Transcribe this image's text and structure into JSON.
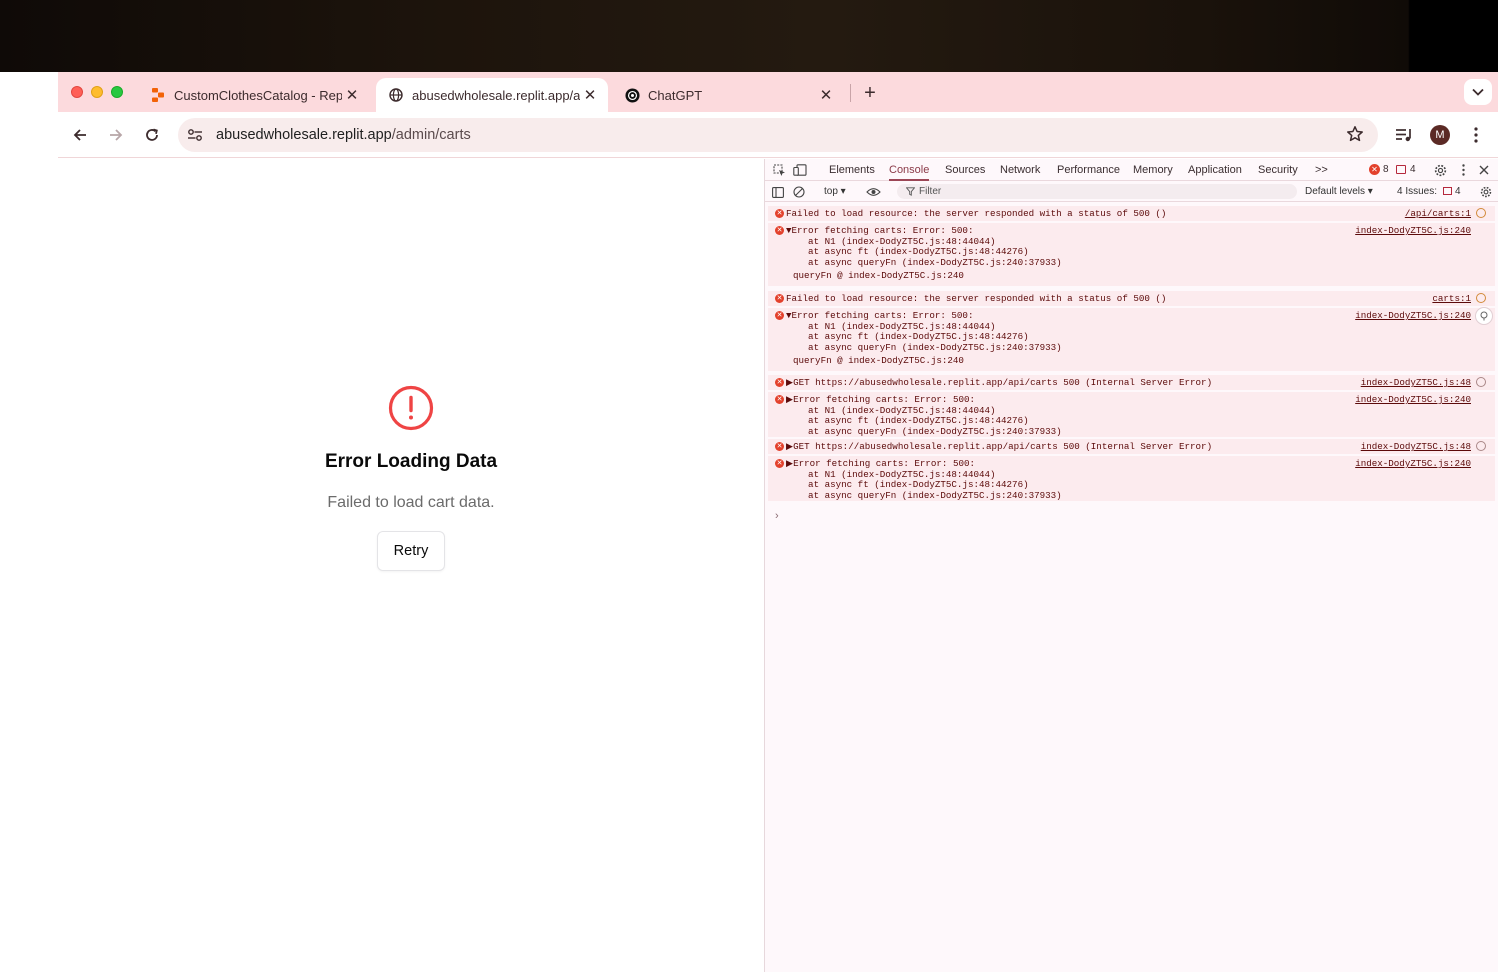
{
  "browser": {
    "tabs": [
      {
        "title": "CustomClothesCatalog - Replit",
        "close": "✕"
      },
      {
        "title": "abusedwholesale.replit.app/admin/carts",
        "close": "✕"
      },
      {
        "title": "ChatGPT",
        "close": "✕"
      }
    ],
    "new_tab": "+",
    "url_host": "abusedwholesale.replit.app",
    "url_path": "/admin/carts",
    "profile_initial": "M"
  },
  "page": {
    "error_title": "Error Loading Data",
    "error_message": "Failed to load cart data.",
    "retry_label": "Retry"
  },
  "devtools": {
    "tabs": [
      "Elements",
      "Console",
      "Sources",
      "Network",
      "Performance",
      "Memory",
      "Application",
      "Security"
    ],
    "more": ">>",
    "error_count": "8",
    "warning_count": "4",
    "context": "top ▾",
    "filter_placeholder": "Filter",
    "levels": "Default levels ▾",
    "issues": "4 Issues:",
    "issues_count": "4",
    "messages": [
      {
        "lines": [
          "Failed to load resource: the server responded with a status of 500 ()"
        ],
        "source": "/api/carts:1"
      },
      {
        "lines": [
          "▼Error fetching carts: Error: 500:",
          "    at N1 (index-DodyZT5C.js:48:44044)",
          "    at async ft (index-DodyZT5C.js:48:44276)",
          "    at async queryFn (index-DodyZT5C.js:240:37933)",
          "queryFn @ index-DodyZT5C.js:240"
        ],
        "source": "index-DodyZT5C.js:240"
      },
      {
        "lines": [
          "Failed to load resource: the server responded with a status of 500 ()"
        ],
        "source": "carts:1"
      },
      {
        "lines": [
          "▼Error fetching carts: Error: 500:",
          "    at N1 (index-DodyZT5C.js:48:44044)",
          "    at async ft (index-DodyZT5C.js:48:44276)",
          "    at async queryFn (index-DodyZT5C.js:240:37933)",
          "queryFn @ index-DodyZT5C.js:240"
        ],
        "source": "index-DodyZT5C.js:240"
      },
      {
        "lines": [
          "▶GET https://abusedwholesale.replit.app/api/carts 500 (Internal Server Error)"
        ],
        "source": "index-DodyZT5C.js:48"
      },
      {
        "lines": [
          "▶Error fetching carts: Error: 500:",
          "    at N1 (index-DodyZT5C.js:48:44044)",
          "    at async ft (index-DodyZT5C.js:48:44276)",
          "    at async queryFn (index-DodyZT5C.js:240:37933)"
        ],
        "source": "index-DodyZT5C.js:240"
      },
      {
        "lines": [
          "▶GET https://abusedwholesale.replit.app/api/carts 500 (Internal Server Error)"
        ],
        "source": "index-DodyZT5C.js:48"
      },
      {
        "lines": [
          "▶Error fetching carts: Error: 500:",
          "    at N1 (index-DodyZT5C.js:48:44044)",
          "    at async ft (index-DodyZT5C.js:48:44276)",
          "    at async queryFn (index-DodyZT5C.js:240:37933)"
        ],
        "source": "index-DodyZT5C.js:240"
      }
    ],
    "prompt": "›"
  }
}
